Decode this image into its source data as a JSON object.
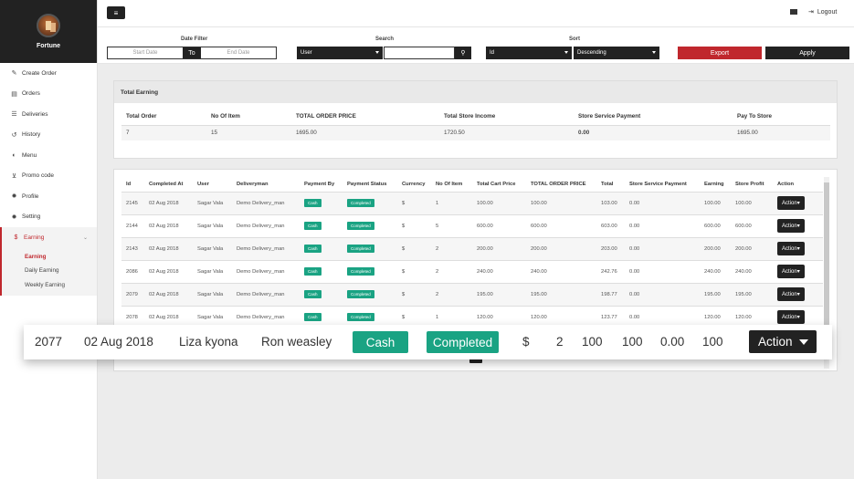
{
  "brand": {
    "name": "Fortune"
  },
  "sidebar": {
    "items": [
      {
        "label": "Create Order",
        "icon": "edit-icon"
      },
      {
        "label": "Orders",
        "icon": "orders-icon"
      },
      {
        "label": "Deliveries",
        "icon": "list-icon"
      },
      {
        "label": "History",
        "icon": "history-icon"
      },
      {
        "label": "Menu",
        "icon": "menu-icon"
      },
      {
        "label": "Promo code",
        "icon": "cart-icon"
      },
      {
        "label": "Profile",
        "icon": "gear-icon"
      },
      {
        "label": "Setting",
        "icon": "gear-icon"
      }
    ],
    "earning": {
      "label": "Earning",
      "icon": "dollar-icon"
    },
    "sub_items": [
      "Earning",
      "Daily Earning",
      "Weekly Earning"
    ]
  },
  "topbar": {
    "logout_label": "Logout"
  },
  "filter": {
    "date_label": "Date Filter",
    "start_placeholder": "Start Date",
    "to_label": "To",
    "end_placeholder": "End Date",
    "search_label": "Search",
    "search_type": "User",
    "sort_label": "Sort",
    "sort_field": "Id",
    "sort_order": "Descending",
    "export_label": "Export",
    "apply_label": "Apply"
  },
  "summary": {
    "title": "Total Earning",
    "headers": [
      "Total Order",
      "No Of Item",
      "TOTAL ORDER PRICE",
      "Total Store Income",
      "Store Service Payment",
      "Pay To Store"
    ],
    "values": [
      "7",
      "15",
      "1695.00",
      "1720.50",
      "0.00",
      "1695.00"
    ]
  },
  "orders": {
    "headers": [
      "Id",
      "Completed At",
      "User",
      "Deliveryman",
      "Payment By",
      "Payment Status",
      "Currency",
      "No Of Item",
      "Total Cart Price",
      "TOTAL ORDER PRICE",
      "Total",
      "Store Service Payment",
      "Earning",
      "Store Profit",
      "Action"
    ],
    "rows": [
      {
        "id": "2145",
        "date": "02 Aug 2018",
        "user": "Sagar Vala",
        "deliveryman": "Demo Delivery_man",
        "pay_by": "Cash",
        "status": "Completed",
        "currency": "$",
        "items": "1",
        "cart": "100.00",
        "order_price": "100.00",
        "total": "103.00",
        "service": "0.00",
        "earning": "100.00",
        "profit": "100.00",
        "action": "Action"
      },
      {
        "id": "2144",
        "date": "02 Aug 2018",
        "user": "Sagar Vala",
        "deliveryman": "Demo Delivery_man",
        "pay_by": "Cash",
        "status": "Completed",
        "currency": "$",
        "items": "5",
        "cart": "600.00",
        "order_price": "600.00",
        "total": "603.00",
        "service": "0.00",
        "earning": "600.00",
        "profit": "600.00",
        "action": "Action"
      },
      {
        "id": "2143",
        "date": "02 Aug 2018",
        "user": "Sagar Vala",
        "deliveryman": "Demo Delivery_man",
        "pay_by": "Cash",
        "status": "Completed",
        "currency": "$",
        "items": "2",
        "cart": "200.00",
        "order_price": "200.00",
        "total": "203.00",
        "service": "0.00",
        "earning": "200.00",
        "profit": "200.00",
        "action": "Action"
      },
      {
        "id": "2086",
        "date": "02 Aug 2018",
        "user": "Sagar Vala",
        "deliveryman": "Demo Delivery_man",
        "pay_by": "Cash",
        "status": "Completed",
        "currency": "$",
        "items": "2",
        "cart": "240.00",
        "order_price": "240.00",
        "total": "242.76",
        "service": "0.00",
        "earning": "240.00",
        "profit": "240.00",
        "action": "Action"
      },
      {
        "id": "2079",
        "date": "02 Aug 2018",
        "user": "Sagar Vala",
        "deliveryman": "Demo Delivery_man",
        "pay_by": "Cash",
        "status": "Completed",
        "currency": "$",
        "items": "2",
        "cart": "195.00",
        "order_price": "195.00",
        "total": "198.77",
        "service": "0.00",
        "earning": "195.00",
        "profit": "195.00",
        "action": "Action"
      },
      {
        "id": "2078",
        "date": "02 Aug 2018",
        "user": "Sagar Vala",
        "deliveryman": "Demo Delivery_man",
        "pay_by": "Cash",
        "status": "Completed",
        "currency": "$",
        "items": "1",
        "cart": "120.00",
        "order_price": "120.00",
        "total": "123.77",
        "service": "0.00",
        "earning": "120.00",
        "profit": "120.00",
        "action": "Action"
      }
    ]
  },
  "highlight": {
    "id": "2077",
    "date": "02 Aug 2018",
    "user": "Liza kyona",
    "deliveryman": "Ron weasley",
    "pay_by": "Cash",
    "status": "Completed",
    "currency": "$",
    "items": "2",
    "cart": "100",
    "order_price": "100",
    "service": "0.00",
    "earning": "100",
    "action": "Action"
  },
  "colors": {
    "accent_red": "#c0272d",
    "badge_green": "#1aa383",
    "dark": "#222222"
  }
}
